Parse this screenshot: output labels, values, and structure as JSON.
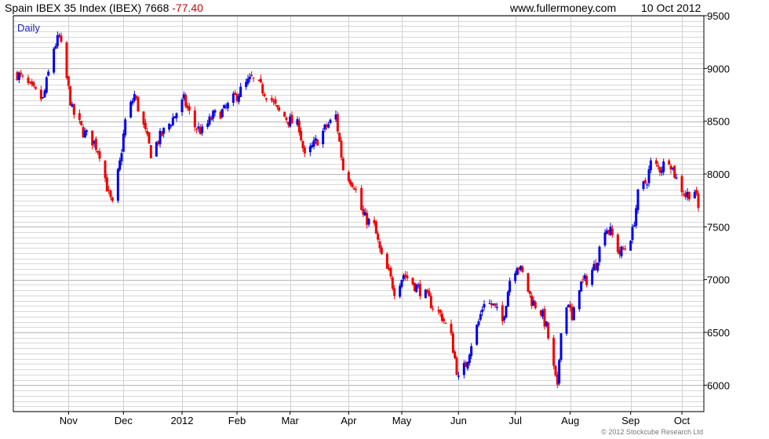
{
  "header": {
    "index_name": "Spain IBEX 35 Index (IBEX)",
    "last_price": "7668",
    "change": "-77.40",
    "website": "www.fullermoney.com",
    "date": "10 Oct 2012"
  },
  "footer": {
    "copyright": "© 2012 Stockcube Research Ltd"
  },
  "colors": {
    "up": "#0000ee",
    "down": "#ee0000",
    "grid": "#d8d8d8",
    "frame": "#000000"
  },
  "chart_data": {
    "type": "candlestick-bars",
    "period_label": "Daily",
    "title": "Spain IBEX 35 Index (IBEX)",
    "xlabel": "",
    "ylabel": "",
    "ylim": [
      5750,
      9500
    ],
    "y_ticks": [
      6000,
      6500,
      7000,
      7500,
      8000,
      8500,
      9000,
      9500
    ],
    "y_tick_labels": [
      "6000",
      "6500",
      "7000",
      "7500",
      "8000",
      "8500",
      "9000",
      "9500"
    ],
    "y_axis_side": "right",
    "x_tick_labels": [
      "Nov",
      "Dec",
      "2012",
      "Feb",
      "Mar",
      "Apr",
      "May",
      "Jun",
      "Jul",
      "Aug",
      "Sep",
      "Oct"
    ],
    "x_tick_dates": [
      "2011-11-01",
      "2011-12-01",
      "2012-01-02",
      "2012-02-01",
      "2012-03-01",
      "2012-04-02",
      "2012-05-01",
      "2012-06-01",
      "2012-07-02",
      "2012-08-01",
      "2012-09-03",
      "2012-10-01"
    ],
    "x_range": [
      "2011-10-04",
      "2012-10-10"
    ],
    "grid": true,
    "series": [
      {
        "path": [
          [
            "2011-10-04",
            8950
          ],
          [
            "2011-10-12",
            8800
          ],
          [
            "2011-10-18",
            8700
          ],
          [
            "2011-10-24",
            9200
          ],
          [
            "2011-10-27",
            9300
          ],
          [
            "2011-10-31",
            8900
          ],
          [
            "2011-11-03",
            8600
          ],
          [
            "2011-11-09",
            8400
          ],
          [
            "2011-11-15",
            8300
          ],
          [
            "2011-11-18",
            8200
          ],
          [
            "2011-11-23",
            7800
          ],
          [
            "2011-11-25",
            7700
          ],
          [
            "2011-11-29",
            8100
          ],
          [
            "2011-12-02",
            8500
          ],
          [
            "2011-12-07",
            8750
          ],
          [
            "2011-12-12",
            8450
          ],
          [
            "2011-12-16",
            8200
          ],
          [
            "2011-12-21",
            8350
          ],
          [
            "2011-12-27",
            8500
          ],
          [
            "2012-01-03",
            8700
          ],
          [
            "2012-01-09",
            8450
          ],
          [
            "2012-01-13",
            8400
          ],
          [
            "2012-01-19",
            8550
          ],
          [
            "2012-01-25",
            8600
          ],
          [
            "2012-02-01",
            8750
          ],
          [
            "2012-02-06",
            8850
          ],
          [
            "2012-02-09",
            8900
          ],
          [
            "2012-02-15",
            8800
          ],
          [
            "2012-02-20",
            8700
          ],
          [
            "2012-02-23",
            8600
          ],
          [
            "2012-03-01",
            8500
          ],
          [
            "2012-03-06",
            8450
          ],
          [
            "2012-03-09",
            8150
          ],
          [
            "2012-03-15",
            8300
          ],
          [
            "2012-03-21",
            8450
          ],
          [
            "2012-03-26",
            8550
          ],
          [
            "2012-03-30",
            8050
          ],
          [
            "2012-04-05",
            7900
          ],
          [
            "2012-04-10",
            7600
          ],
          [
            "2012-04-16",
            7500
          ],
          [
            "2012-04-20",
            7200
          ],
          [
            "2012-04-24",
            7050
          ],
          [
            "2012-04-27",
            6900
          ],
          [
            "2012-05-02",
            7050
          ],
          [
            "2012-05-08",
            6950
          ],
          [
            "2012-05-14",
            6850
          ],
          [
            "2012-05-18",
            6750
          ],
          [
            "2012-05-23",
            6650
          ],
          [
            "2012-05-28",
            6450
          ],
          [
            "2012-06-01",
            6050
          ],
          [
            "2012-06-05",
            6200
          ],
          [
            "2012-06-08",
            6400
          ],
          [
            "2012-06-12",
            6600
          ],
          [
            "2012-06-15",
            6800
          ],
          [
            "2012-06-20",
            6750
          ],
          [
            "2012-06-25",
            6600
          ],
          [
            "2012-06-29",
            7000
          ],
          [
            "2012-07-03",
            7150
          ],
          [
            "2012-07-06",
            7050
          ],
          [
            "2012-07-11",
            6800
          ],
          [
            "2012-07-16",
            6700
          ],
          [
            "2012-07-19",
            6550
          ],
          [
            "2012-07-23",
            6150
          ],
          [
            "2012-07-25",
            5950
          ],
          [
            "2012-07-27",
            6550
          ],
          [
            "2012-07-31",
            6800
          ],
          [
            "2012-08-02",
            6600
          ],
          [
            "2012-08-06",
            6950
          ],
          [
            "2012-08-10",
            7000
          ],
          [
            "2012-08-15",
            7150
          ],
          [
            "2012-08-20",
            7500
          ],
          [
            "2012-08-23",
            7450
          ],
          [
            "2012-08-28",
            7250
          ],
          [
            "2012-08-31",
            7300
          ],
          [
            "2012-09-04",
            7450
          ],
          [
            "2012-09-07",
            7800
          ],
          [
            "2012-09-12",
            7950
          ],
          [
            "2012-09-14",
            8100
          ],
          [
            "2012-09-19",
            8050
          ],
          [
            "2012-09-24",
            8150
          ],
          [
            "2012-09-28",
            7950
          ],
          [
            "2012-10-03",
            7800
          ],
          [
            "2012-10-08",
            7850
          ],
          [
            "2012-10-10",
            7668
          ]
        ]
      }
    ]
  }
}
